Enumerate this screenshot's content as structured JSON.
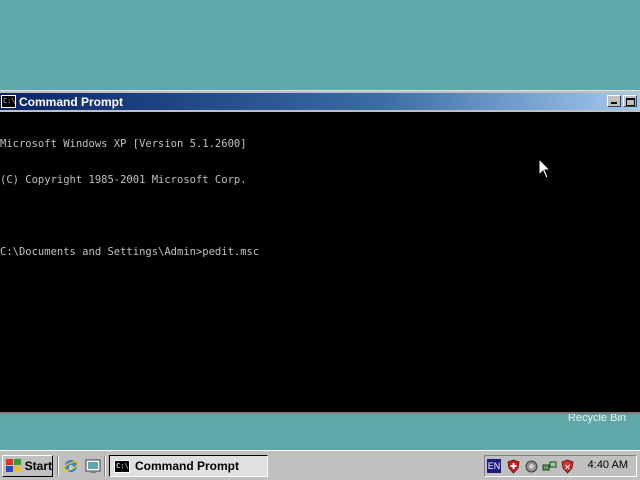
{
  "desktop": {
    "recycle_bin_label": "Recycle Bin"
  },
  "window": {
    "title": "Command Prompt",
    "icon_text": "C:\\",
    "console_lines": [
      "Microsoft Windows XP [Version 5.1.2600]",
      "(C) Copyright 1985-2001 Microsoft Corp.",
      "",
      "C:\\Documents and Settings\\Admin>pedit.msc"
    ]
  },
  "taskbar": {
    "start_label": "Start",
    "quicklaunch": [
      "internet-explorer-icon",
      "show-desktop-icon"
    ],
    "tasks": [
      {
        "label": "Command Prompt",
        "icon": "console-icon"
      }
    ],
    "tray": {
      "language": "EN",
      "icons": [
        "security-shield-icon",
        "network-icon",
        "network-activity-icon",
        "security-alert-icon"
      ],
      "clock": "4:40 AM"
    }
  },
  "colors": {
    "desktop": "#5fa7a9",
    "titlebar_start": "#0a246a",
    "titlebar_end": "#a6caf0",
    "console_bg": "#000000",
    "console_text": "#c0c0c0"
  }
}
